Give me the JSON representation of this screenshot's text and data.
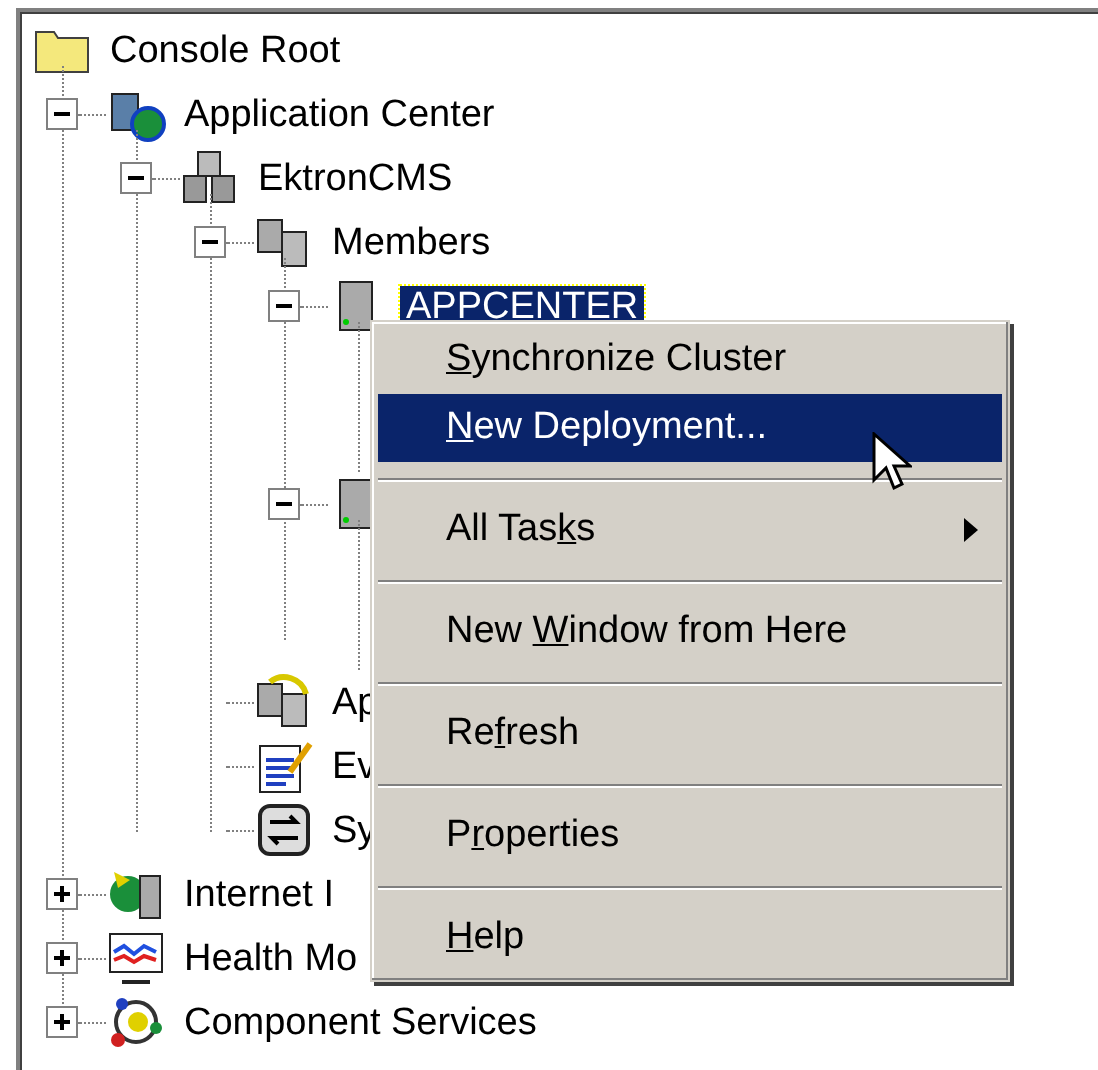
{
  "tree": [
    {
      "label": "Console Root",
      "kind": "folder",
      "selected": false,
      "children": [
        {
          "label": "Application Center",
          "kind": "app-center",
          "expanded": true,
          "selected": false,
          "children": [
            {
              "label": "EktronCMS",
              "kind": "cluster",
              "expanded": true,
              "selected": false,
              "children": [
                {
                  "label": "Members",
                  "kind": "members",
                  "expanded": true,
                  "selected": false,
                  "children": [
                    {
                      "label": "APPCENTER",
                      "kind": "server",
                      "expanded": true,
                      "selected": true
                    },
                    {
                      "kind": "server",
                      "expanded": true
                    }
                  ]
                },
                {
                  "label": "Ap",
                  "kind": "applications",
                  "selected": false
                },
                {
                  "label": "Ev",
                  "kind": "events",
                  "selected": false
                },
                {
                  "label": "Sy",
                  "kind": "sync",
                  "selected": false
                }
              ]
            }
          ]
        },
        {
          "label": "Internet I",
          "kind": "iis",
          "expanded": false,
          "selected": false
        },
        {
          "label": "Health Mo",
          "kind": "health",
          "expanded": false,
          "selected": false
        },
        {
          "label": "Component Services",
          "kind": "component",
          "expanded": false,
          "selected": false
        }
      ]
    }
  ],
  "context_menu": {
    "groups": [
      [
        {
          "key": "S",
          "after": "ynchronize Cluster",
          "selected": false
        },
        {
          "key": "N",
          "after": "ew Deployment...",
          "selected": true
        }
      ],
      [
        {
          "before": "All Tas",
          "key": "k",
          "after": "s",
          "selected": false,
          "submenu": true
        }
      ],
      [
        {
          "before": "New ",
          "key": "W",
          "after": "indow from Here",
          "selected": false
        }
      ],
      [
        {
          "before": "Re",
          "key": "f",
          "after": "resh",
          "selected": false
        }
      ],
      [
        {
          "before": "P",
          "key": "r",
          "after": "operties",
          "selected": false
        }
      ],
      [
        {
          "key": "H",
          "after": "elp",
          "selected": false
        }
      ]
    ]
  }
}
